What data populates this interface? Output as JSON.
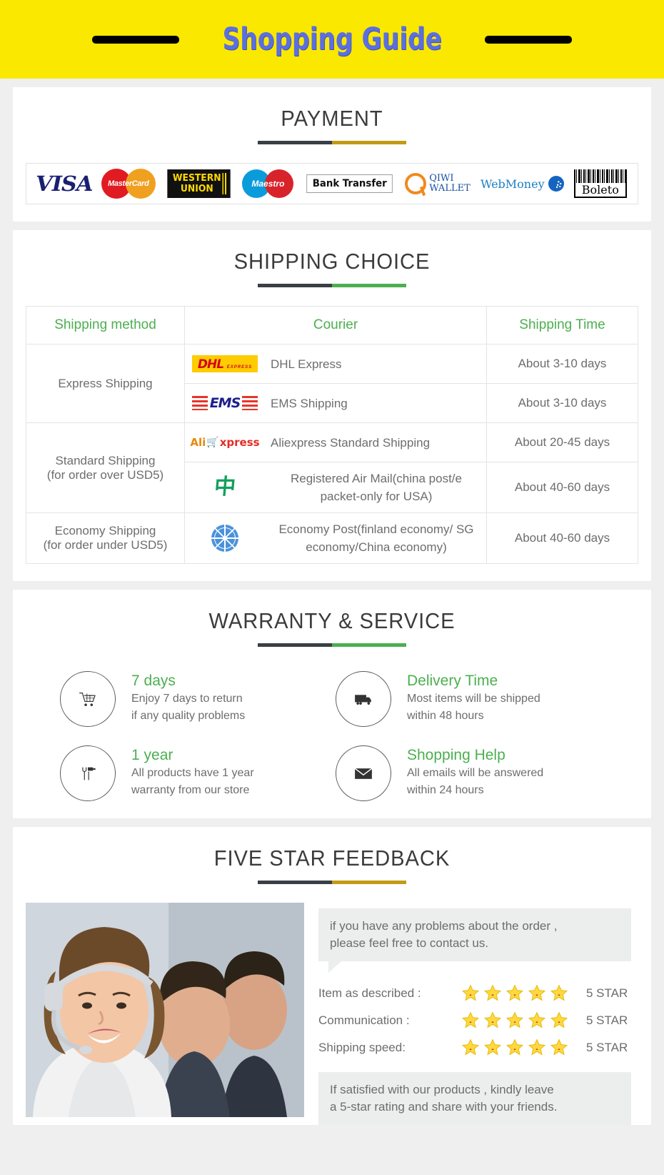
{
  "banner": {
    "title": "Shopping Guide"
  },
  "payment": {
    "title": "PAYMENT",
    "methods": [
      {
        "name": "visa-logo",
        "label": "VISA"
      },
      {
        "name": "mastercard-logo",
        "label": "MasterCard"
      },
      {
        "name": "western-union-logo",
        "line1": "WESTERN",
        "line2": "UNION"
      },
      {
        "name": "maestro-logo",
        "label": "Maestro"
      },
      {
        "name": "bank-transfer-logo",
        "label": "Bank Transfer"
      },
      {
        "name": "qiwi-wallet-logo",
        "line1": "QIWI",
        "line2": "WALLET"
      },
      {
        "name": "webmoney-logo",
        "label": "WebMoney"
      },
      {
        "name": "boleto-logo",
        "label": "Boleto"
      }
    ]
  },
  "shipping": {
    "title": "SHIPPING CHOICE",
    "headers": [
      "Shipping method",
      "Courier",
      "Shipping Time"
    ],
    "rows": [
      {
        "method": "Express Shipping",
        "courier_logo": "dhl-logo",
        "courier": "DHL Express",
        "time": "About 3-10 days"
      },
      {
        "method": "",
        "courier_logo": "ems-logo",
        "courier": "EMS Shipping",
        "time": "About 3-10 days"
      },
      {
        "method": "Standard Shipping\n(for order over USD5)",
        "courier_logo": "aliexpress-logo",
        "courier": "Aliexpress Standard Shipping",
        "time": "About 20-45 days"
      },
      {
        "method": "",
        "courier_logo": "china-post-logo",
        "courier": "Registered Air Mail(china post/e packet-only for USA)",
        "time": "About 40-60 days"
      },
      {
        "method": "Economy Shipping\n(for order under USD5)",
        "courier_logo": "un-post-logo",
        "courier": "Economy Post(finland economy/ SG economy/China economy)",
        "time": "About 40-60 days"
      }
    ],
    "method_cells": [
      "Express Shipping",
      "Standard Shipping\n(for order over USD5)",
      "Economy Shipping\n(for order under USD5)"
    ],
    "dhl": {
      "main": "DHL",
      "sub": "EXPRESS"
    },
    "ems": {
      "label": "EMS"
    },
    "aliexpress": {
      "part1": "Ali",
      "part2": "xpress"
    }
  },
  "warranty": {
    "title": "WARRANTY & SERVICE",
    "items": [
      {
        "icon": "shopping-cart-icon",
        "title": "7 days",
        "desc": "Enjoy 7 days to return\nif any quality problems"
      },
      {
        "icon": "truck-icon",
        "title": "Delivery Time",
        "desc": "Most items will be shipped\nwithin 48 hours"
      },
      {
        "icon": "tools-icon",
        "title": "1 year",
        "desc": "All products have 1 year\nwarranty from our store"
      },
      {
        "icon": "envelope-icon",
        "title": "Shopping Help",
        "desc": "All emails will be answered\nwithin 24 hours"
      }
    ]
  },
  "feedback": {
    "title": "FIVE STAR FEEDBACK",
    "top_bubble": "if you have any problems about the order ,\nplease feel free to contact us.",
    "bottom_bubble": "If satisfied with our products ,  kindly leave\na 5-star rating and share with your friends.",
    "ratings": [
      {
        "label": "Item as described :",
        "stars": 5,
        "value": "5 STAR"
      },
      {
        "label": "Communication :",
        "stars": 5,
        "value": "5 STAR"
      },
      {
        "label": "Shipping speed:",
        "stars": 5,
        "value": "5 STAR"
      }
    ]
  },
  "colors": {
    "banner_bg": "#fae800",
    "banner_text": "#5b6fe0",
    "green": "#4caf50",
    "gold": "#c39a16",
    "dark": "#3a3f45",
    "body_text": "#6d6d6d",
    "star": "#ffd93d"
  }
}
